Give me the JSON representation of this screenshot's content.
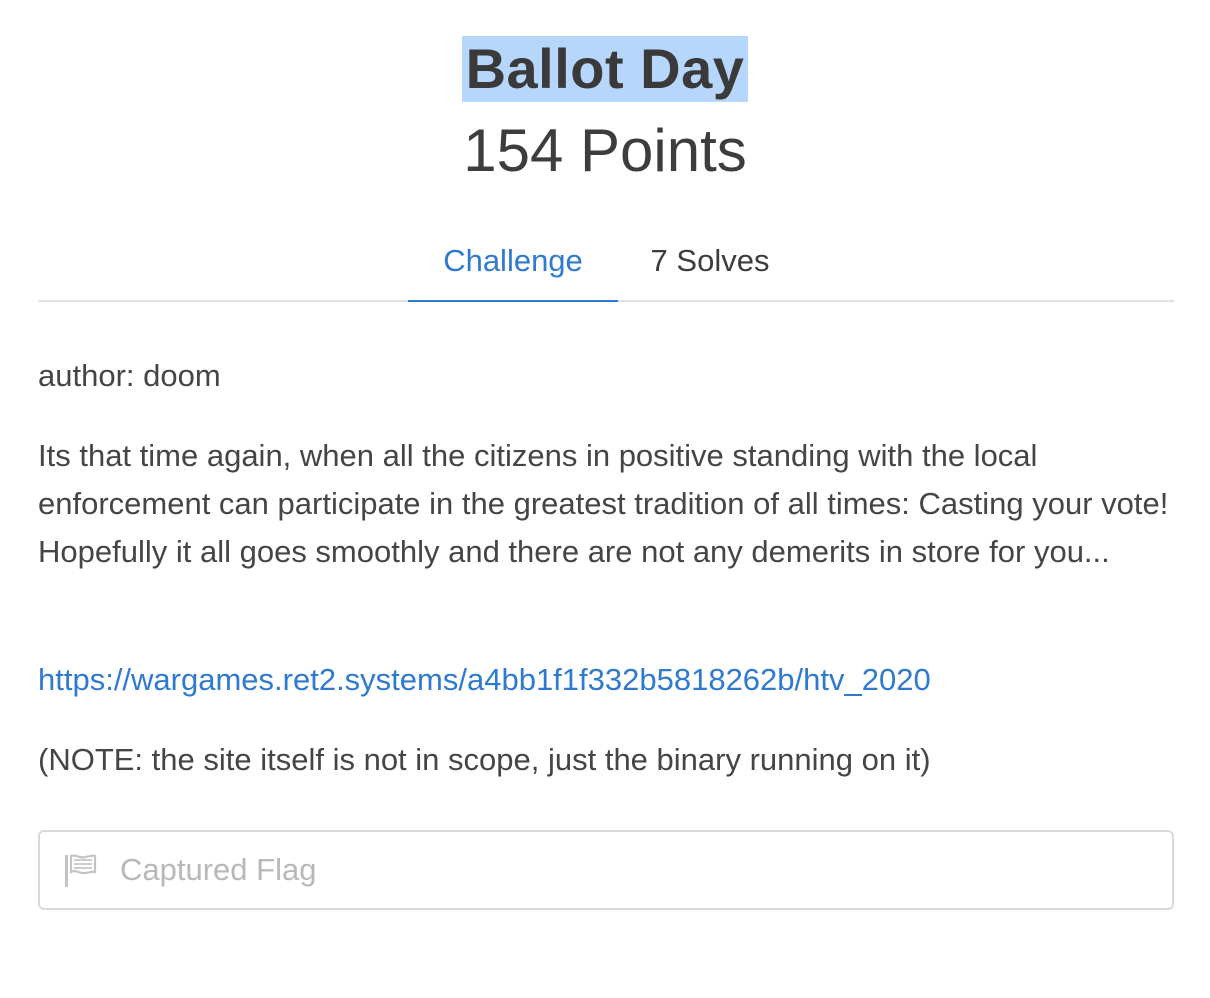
{
  "challenge": {
    "title": "Ballot Day",
    "points": "154 Points"
  },
  "tabs": [
    {
      "label": "Challenge",
      "active": true
    },
    {
      "label": "7 Solves",
      "active": false
    }
  ],
  "description": {
    "author": "author: doom",
    "body": "Its that time again, when all the citizens in positive standing with the local enforcement can participate in the greatest tradition of all times: Casting your vote! Hopefully it all goes smoothly and there are not any demerits in store for you...",
    "link": "https://wargames.ret2.systems/a4bb1f1f332b5818262b/htv_2020",
    "note": "(NOTE: the site itself is not in scope, just the binary running on it)"
  },
  "flag_input": {
    "placeholder": "Captured Flag",
    "value": "",
    "icon": "flag-icon"
  },
  "colors": {
    "accent": "#2f7ad1",
    "title_highlight": "#b6d6fb",
    "text": "#3d3d3d",
    "border": "#d9d9d9",
    "placeholder": "#b8b8b8"
  }
}
